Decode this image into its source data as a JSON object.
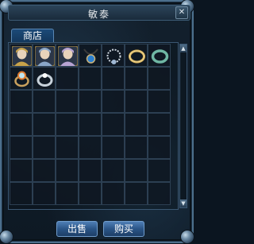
{
  "window": {
    "title": "敏泰",
    "close_label": "✕"
  },
  "tabs": [
    {
      "label": "商店"
    }
  ],
  "buttons": {
    "sell_label": "出售",
    "buy_label": "购买"
  },
  "scrollbar": {
    "up": "▲",
    "down": "▼"
  },
  "grid": {
    "rows": 7,
    "cols": 7
  },
  "items": [
    {
      "name": "portrait-item-1",
      "icon": "character-portrait-icon",
      "color": "#c8a24a"
    },
    {
      "name": "portrait-item-2",
      "icon": "character-portrait-icon",
      "color": "#8aa6c8"
    },
    {
      "name": "portrait-item-3",
      "icon": "character-portrait-icon",
      "color": "#b7a3d2"
    },
    {
      "name": "amulet-item",
      "icon": "amulet-icon",
      "color": "#2a7fd0"
    },
    {
      "name": "necklace-item",
      "icon": "necklace-icon",
      "color": "#cfd7e0"
    },
    {
      "name": "gold-ring-item",
      "icon": "gold-ring-icon",
      "color": "#d8b25a"
    },
    {
      "name": "jade-ring-item",
      "icon": "jade-ring-icon",
      "color": "#6fb7a4"
    },
    {
      "name": "gem-ring-item",
      "icon": "gem-ring-icon",
      "color": "#e07a2f"
    },
    {
      "name": "silver-ring-item",
      "icon": "silver-ring-icon",
      "color": "#c9d3dc"
    }
  ]
}
